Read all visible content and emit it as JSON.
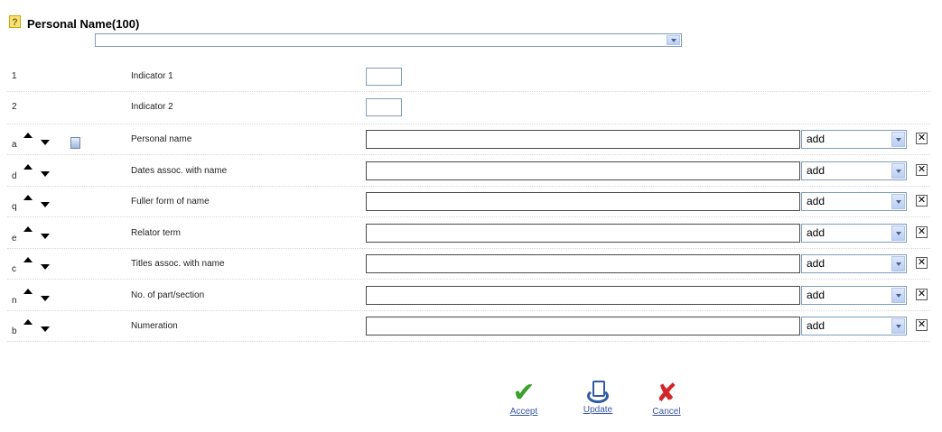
{
  "header": {
    "help_glyph": "?",
    "title": "Personal Name(100)",
    "top_select_value": ""
  },
  "indicators": [
    {
      "code": "1",
      "label": "Indicator 1",
      "value": ""
    },
    {
      "code": "2",
      "label": "Indicator 2",
      "value": ""
    }
  ],
  "subfields": [
    {
      "code": "a",
      "label": "Personal name",
      "value": "",
      "mode": "add",
      "has_page_icon": true
    },
    {
      "code": "d",
      "label": "Dates assoc. with name",
      "value": "",
      "mode": "add"
    },
    {
      "code": "q",
      "label": "Fuller form of name",
      "value": "",
      "mode": "add"
    },
    {
      "code": "e",
      "label": "Relator term",
      "value": "",
      "mode": "add"
    },
    {
      "code": "c",
      "label": "Titles assoc. with name",
      "value": "",
      "mode": "add"
    },
    {
      "code": "n",
      "label": "No. of part/section",
      "value": "",
      "mode": "add"
    },
    {
      "code": "b",
      "label": "Numeration",
      "value": "",
      "mode": "add"
    }
  ],
  "delete_glyph": "✕",
  "actions": {
    "accept": "Accept",
    "update": "Update",
    "cancel": "Cancel",
    "accept_glyph": "✔",
    "cancel_glyph": "✘"
  },
  "colors": {
    "accept": "#3aa12a",
    "update": "#2f5aa8",
    "cancel": "#d4262a",
    "link": "#3a57a8"
  }
}
